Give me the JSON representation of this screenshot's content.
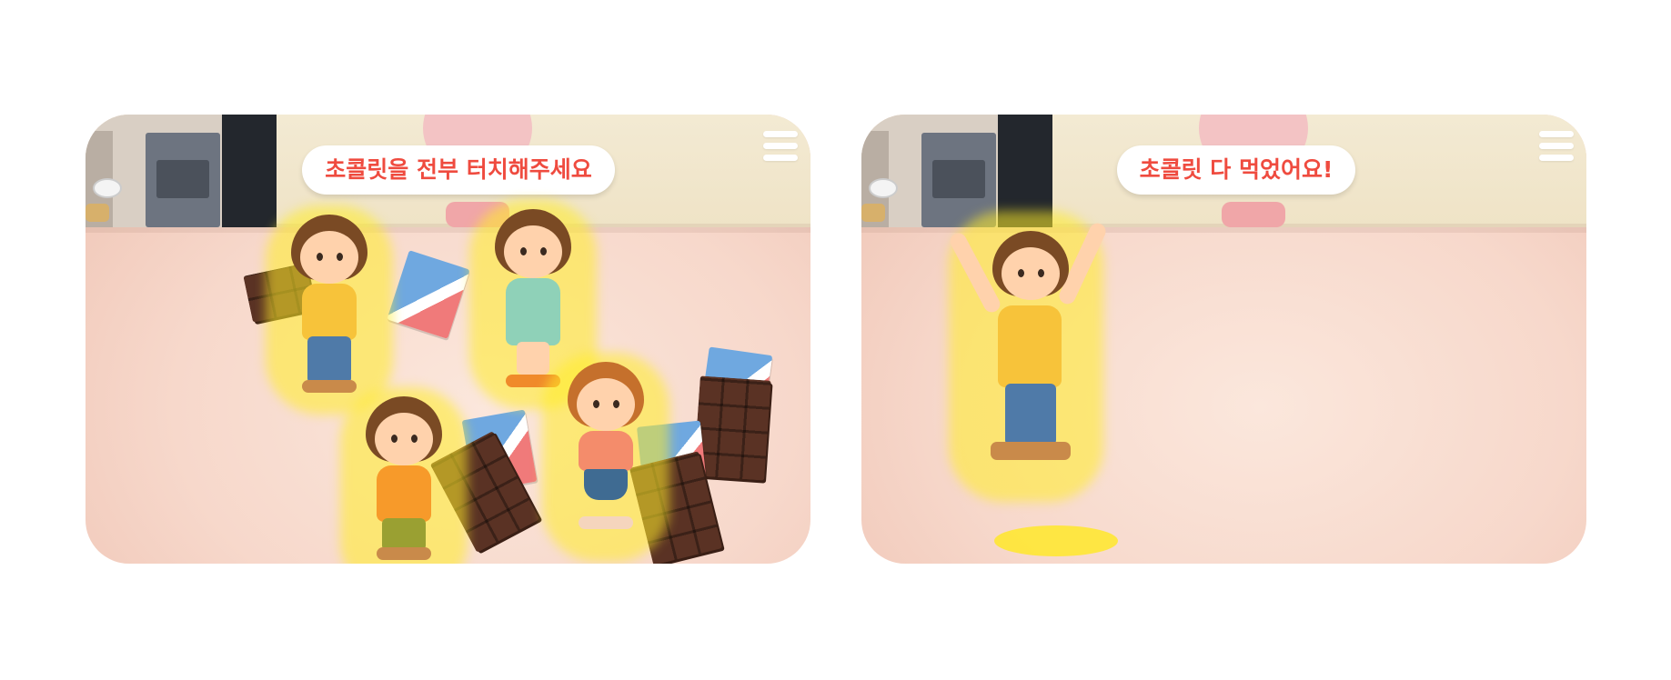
{
  "screens": [
    {
      "speech_text": "초콜릿을 전부 터치해주세요",
      "menu_icon": "hamburger-menu-icon",
      "kids": [
        "yellow-shirt-girl",
        "mint-dress-girl",
        "orange-shirt-boy",
        "coral-shirt-girl"
      ],
      "chocolate_bars": 4
    },
    {
      "speech_text": "초콜릿 다 먹었어요!",
      "menu_icon": "hamburger-menu-icon",
      "kids": [
        "jumping-yellow-shirt-girl"
      ]
    }
  ],
  "colors": {
    "speech_text": "#ef4b3f",
    "highlight_glow": "#ffe72a",
    "floor": "#f7d8cb"
  }
}
